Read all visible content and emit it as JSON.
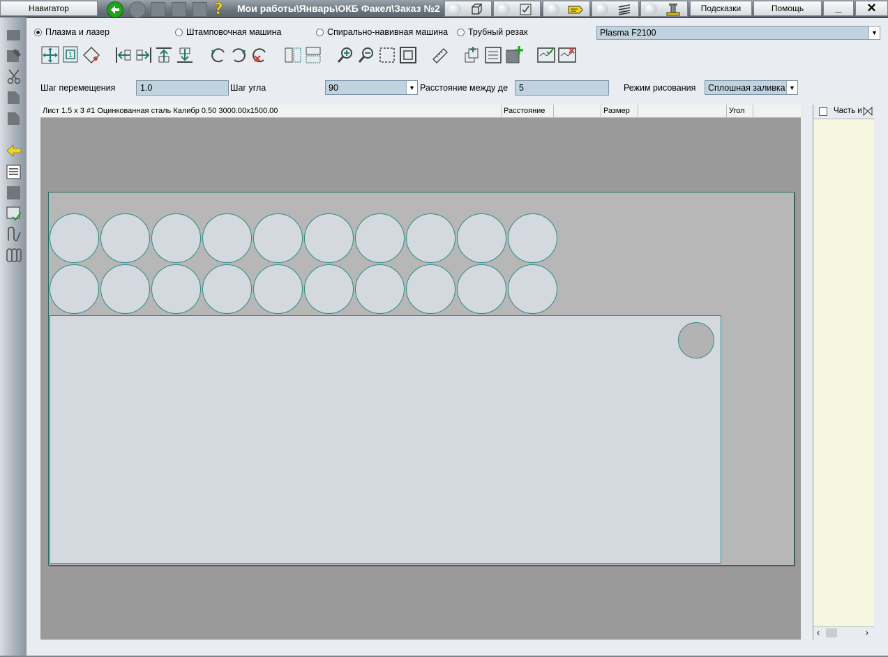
{
  "titlebar": {
    "navigator_label": "Навигатор",
    "path": "Мои работы\\Январь\\ОКБ Факел\\Заказ №2",
    "hints_label": "Подсказки",
    "help_label": "Помощь",
    "minimize_glyph": "_",
    "close_glyph": "✕"
  },
  "machine_types": {
    "options": [
      "Плазма и лазер",
      "Штамповочная машина",
      "Спирально-навивная машина",
      "Трубный резак"
    ],
    "selected": "Плазма и лазер"
  },
  "machine_select": {
    "value": "Plasma F2100"
  },
  "params": {
    "move_step_label": "Шаг перемещения",
    "move_step_value": "1.0",
    "angle_step_label": "Шаг угла",
    "angle_step_value": "90",
    "distance_label": "Расстояние между дет",
    "distance_value": "5",
    "draw_mode_label": "Режим рисования",
    "draw_mode_value": "Сплошная заливка"
  },
  "canvas": {
    "sheet_info": "Лист 1.5 x 3 #1 Оцинкованная сталь Калибр 0.50 3000.00x1500.00",
    "col_distance": "Расстояние",
    "col_size": "Размер",
    "col_angle": "Угол",
    "circle_rows": 2,
    "circles_per_row": 10
  },
  "right_panel": {
    "header": "Часть и"
  },
  "icons": {
    "toolbar": [
      "move-part-icon",
      "transform-icon",
      "rotate-part-icon",
      "align-left-icon",
      "align-right-icon",
      "align-top-icon",
      "align-bottom-icon",
      "rotate-ccw-icon",
      "rotate-cw-icon",
      "rotate-delete-icon",
      "copy-horizontal-icon",
      "copy-vertical-icon",
      "zoom-in-icon",
      "zoom-out-icon",
      "zoom-window-icon",
      "zoom-fit-icon",
      "measure-icon",
      "add-part-icon",
      "part-list-icon",
      "add-sheet-icon",
      "nest-accept-icon",
      "nest-reject-icon"
    ],
    "sidebar": [
      "sheet-icon",
      "edit-icon",
      "cut-icon",
      "copy-icon",
      "paste-icon",
      "back-arrow-icon",
      "list-icon",
      "blank-icon",
      "check-sheet-icon",
      "path-icon",
      "chain-icon"
    ]
  },
  "colors": {
    "accent_teal": "#2f8c84",
    "sheet_fill": "#b7b7b7",
    "part_fill": "#d3d9de",
    "field_fill": "#c2d3e0",
    "back_green": "#1fa318",
    "hint_yellow": "#f2d51b"
  }
}
